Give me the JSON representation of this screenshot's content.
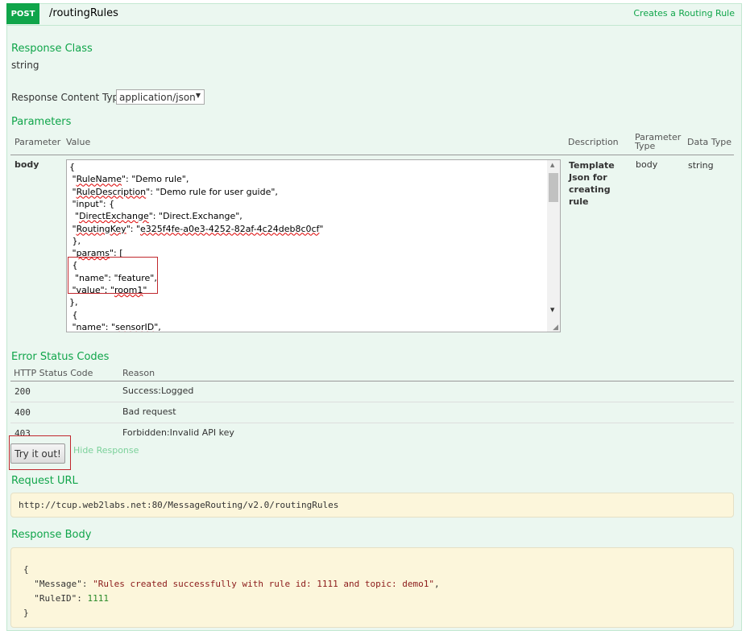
{
  "operation": {
    "method": "POST",
    "path": "/routingRules",
    "summary": "Creates a Routing Rule",
    "color": "#10a54a"
  },
  "response_class": {
    "heading": "Response Class",
    "value": "string"
  },
  "content_type": {
    "label": "Response Content Type",
    "selected": "application/json"
  },
  "parameters": {
    "heading": "Parameters",
    "headers": [
      "Parameter",
      "Value",
      "Description",
      "Parameter Type",
      "Data Type"
    ],
    "row": {
      "name": "body",
      "description": "Template Json for creating rule",
      "param_type": "body",
      "data_type": "string",
      "value_lines": [
        "{",
        " \"RuleName\": \"Demo rule\",",
        " \"RuleDescription\": \"Demo rule for user guide\",",
        " \"input\": {",
        "  \"DirectExchange\": \"Direct.Exchange\",",
        " \"RoutingKey\": \"e325f4fe-a0e3-4252-82af-4c24deb8c0cf\"",
        " },",
        " \"params\": [",
        " {",
        "  \"name\": \"feature\",",
        " \"value\": \"room1\"",
        "},",
        " {",
        " \"name\": \"sensorID\","
      ]
    }
  },
  "errors": {
    "heading": "Error Status Codes",
    "headers": [
      "HTTP Status Code",
      "Reason"
    ],
    "rows": [
      {
        "code": "200",
        "reason": "Success:Logged"
      },
      {
        "code": "400",
        "reason": "Bad request"
      },
      {
        "code": "403",
        "reason": "Forbidden:Invalid API key"
      }
    ]
  },
  "actions": {
    "try": "Try it out!",
    "hide": "Hide Response"
  },
  "request_url": {
    "heading": "Request URL",
    "value": "http://tcup.web2labs.net:80/MessageRouting/v2.0/routingRules"
  },
  "response_body": {
    "heading": "Response Body",
    "open": "{",
    "key1": "\"Message\"",
    "val1": "\"Rules created successfully with rule id: 1111 and topic: demo1\"",
    "key2": "\"RuleID\"",
    "val2": "1111",
    "close": "}"
  }
}
